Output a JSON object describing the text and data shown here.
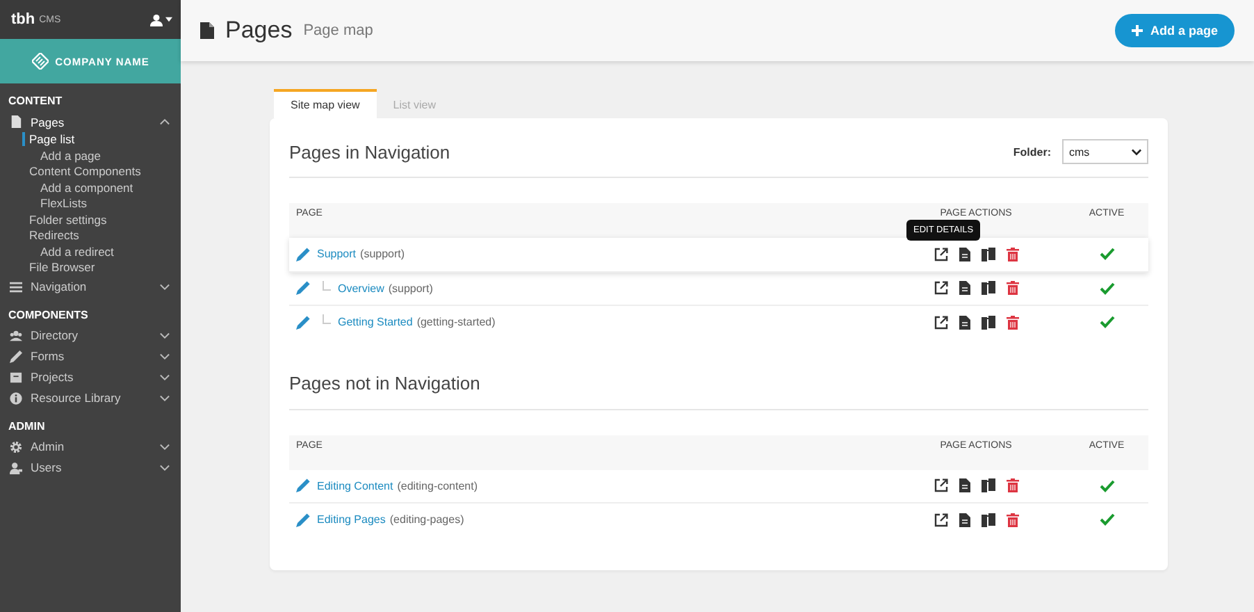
{
  "sidebar": {
    "brand_mark": "tbh",
    "brand": "CMS",
    "company": "COMPANY NAME",
    "sections": [
      {
        "title": "CONTENT",
        "items": [
          {
            "label": "Pages",
            "expanded": true,
            "children": [
              {
                "label": "Page list",
                "selected": true,
                "children": [
                  {
                    "label": "Add a page",
                    "selected": false
                  }
                ]
              },
              {
                "label": "Content Components",
                "selected": false,
                "children": [
                  {
                    "label": "Add a component",
                    "selected": false
                  },
                  {
                    "label": "FlexLists",
                    "selected": false
                  }
                ]
              },
              {
                "label": "Folder settings",
                "selected": false
              },
              {
                "label": "Redirects",
                "selected": false,
                "children": [
                  {
                    "label": "Add a redirect",
                    "selected": false
                  }
                ]
              },
              {
                "label": "File Browser",
                "selected": false
              }
            ]
          },
          {
            "label": "Navigation",
            "expanded": false
          }
        ]
      },
      {
        "title": "COMPONENTS",
        "items": [
          {
            "label": "Directory",
            "expanded": false
          },
          {
            "label": "Forms",
            "expanded": false
          },
          {
            "label": "Projects",
            "expanded": false
          },
          {
            "label": "Resource Library",
            "expanded": false
          }
        ]
      },
      {
        "title": "ADMIN",
        "items": [
          {
            "label": "Admin",
            "expanded": false
          },
          {
            "label": "Users",
            "expanded": false
          }
        ]
      }
    ]
  },
  "header": {
    "title": "Pages",
    "subtitle": "Page map",
    "button": "Add a page"
  },
  "tabs": [
    {
      "label": "Site map view",
      "selected": true
    },
    {
      "label": "List view",
      "selected": false
    }
  ],
  "folder": {
    "label": "Folder:",
    "value": "cms"
  },
  "tables": [
    {
      "title": "Pages in Navigation",
      "columns": [
        "PAGE",
        "PAGE ACTIONS",
        "ACTIVE"
      ],
      "rows": [
        {
          "name": "Support",
          "slug": "(support)",
          "active": true,
          "hovered": true,
          "tooltip": "EDIT DETAILS",
          "children": [
            {
              "name": "Overview",
              "slug": "(support)",
              "active": true,
              "hovered": false
            },
            {
              "name": "Getting Started",
              "slug": "(getting-started)",
              "active": true,
              "hovered": false
            }
          ]
        }
      ]
    },
    {
      "title": "Pages not in Navigation",
      "columns": [
        "PAGE",
        "PAGE ACTIONS",
        "ACTIVE"
      ],
      "rows": [
        {
          "name": "Editing Content",
          "slug": "(editing-content)",
          "active": true,
          "hovered": false
        },
        {
          "name": "Editing Pages",
          "slug": "(editing-pages)",
          "active": true,
          "hovered": false
        }
      ]
    }
  ]
}
